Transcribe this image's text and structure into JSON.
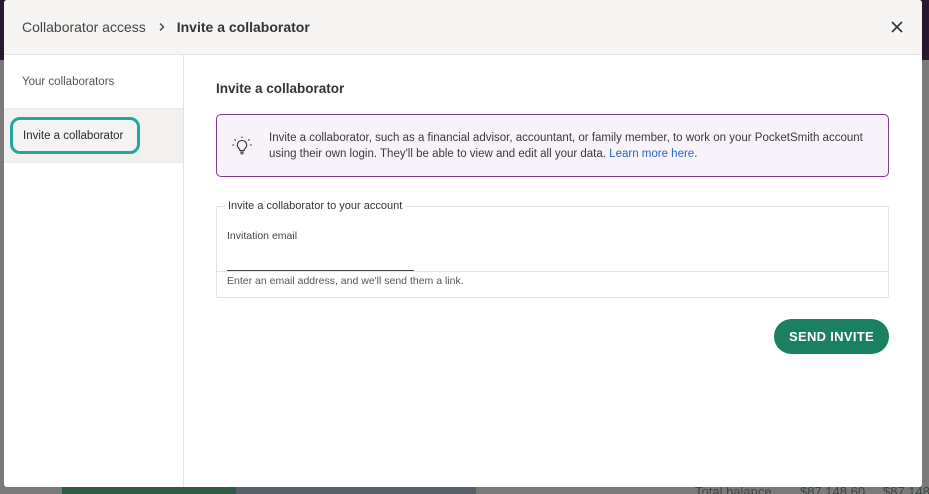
{
  "background": {
    "fragments": [
      {
        "text": "Total balance",
        "kind": "plain"
      },
      {
        "text": "$87,148.60",
        "kind": "plain"
      },
      {
        "text": "$87,148",
        "kind": "plain"
      }
    ]
  },
  "header": {
    "breadcrumb_root": "Collaborator access",
    "breadcrumb_current": "Invite a collaborator"
  },
  "sidebar": {
    "items": [
      {
        "label": "Your collaborators"
      },
      {
        "label": "Invite a collaborator"
      }
    ]
  },
  "main": {
    "title": "Invite a collaborator",
    "info": {
      "text": "Invite a collaborator, such as a financial advisor, accountant, or family member, to work on your PocketSmith account using their own login. They'll be able to view and edit all your data. ",
      "link": "Learn more here",
      "link_suffix": "."
    },
    "form": {
      "legend": "Invite a collaborator to your account",
      "email_label": "Invitation email",
      "email_value": "",
      "email_placeholder": "",
      "helper": "Enter an email address, and we'll send them a link."
    },
    "send_button": "SEND INVITE"
  },
  "colors": {
    "accent_green": "#1b7f62",
    "focus_teal": "#1ea99a",
    "info_border": "#7b3d86",
    "link_blue": "#2b62c8"
  }
}
